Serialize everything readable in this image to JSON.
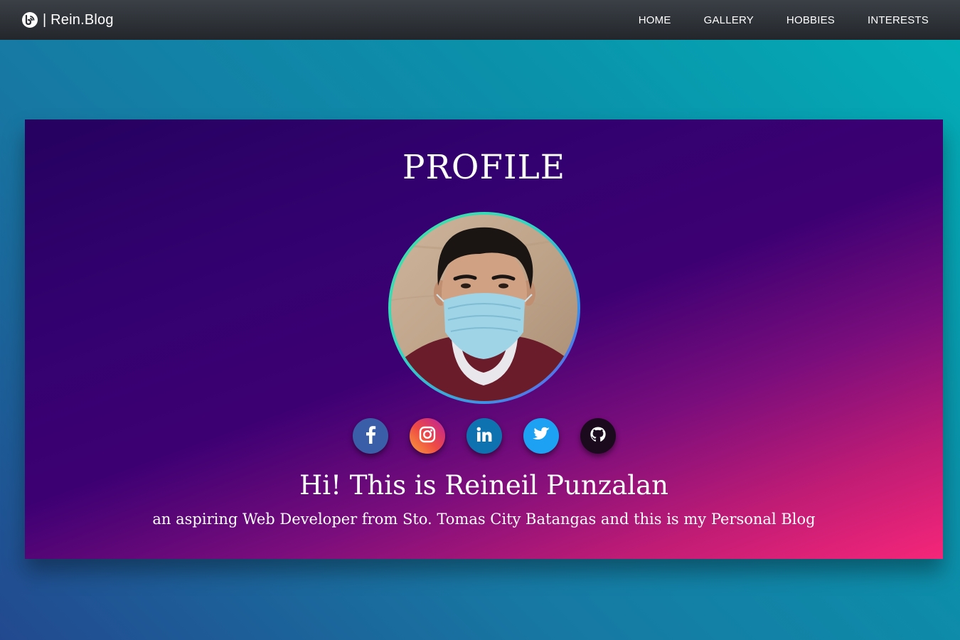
{
  "navbar": {
    "brand_icon": "blog-feed-icon",
    "brand": "| Rein.Blog",
    "links": [
      "HOME",
      "GALLERY",
      "HOBBIES",
      "INTERESTS"
    ]
  },
  "profile": {
    "title": "PROFILE",
    "greeting": "Hi! This is Reineil Punzalan",
    "tagline": "an aspiring Web Developer from Sto. Tomas City Batangas and this is my Personal Blog",
    "social": [
      {
        "icon": "facebook-icon",
        "color": "#3b5ea8"
      },
      {
        "icon": "instagram-icon",
        "color": "#e1306c"
      },
      {
        "icon": "linkedin-icon",
        "color": "#0e72b0"
      },
      {
        "icon": "twitter-icon",
        "color": "#1da1f2"
      },
      {
        "icon": "github-icon",
        "color": "#1b0a1e"
      }
    ]
  },
  "colors": {
    "navbar": "#2a2e33",
    "card_start": "#250160",
    "card_end": "#f52679",
    "page_bg_start": "#22498f",
    "page_bg_end": "#02b0b8"
  }
}
